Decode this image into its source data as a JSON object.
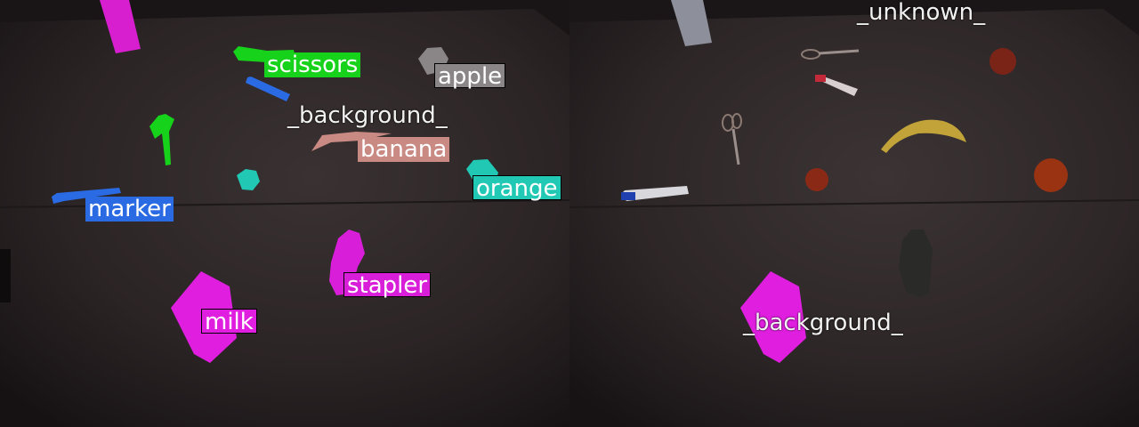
{
  "scene": {
    "left_labels": [
      {
        "key": "scissors",
        "text": "scissors",
        "color": "#16d21a"
      },
      {
        "key": "apple",
        "text": "apple",
        "color": "#8a8586"
      },
      {
        "key": "background",
        "text": "_background_",
        "color": ""
      },
      {
        "key": "banana",
        "text": "banana",
        "color": "#c98a83"
      },
      {
        "key": "orange",
        "text": "orange",
        "color": "#21c9b4"
      },
      {
        "key": "marker",
        "text": "marker",
        "color": "#2a6ae2"
      },
      {
        "key": "stapler",
        "text": "stapler",
        "color": "#d81ed8"
      },
      {
        "key": "milk",
        "text": "milk",
        "color": "#e01ee0"
      }
    ],
    "right_labels": [
      {
        "key": "unknown",
        "text": "_unknown_"
      },
      {
        "key": "background",
        "text": "_background_"
      }
    ]
  }
}
